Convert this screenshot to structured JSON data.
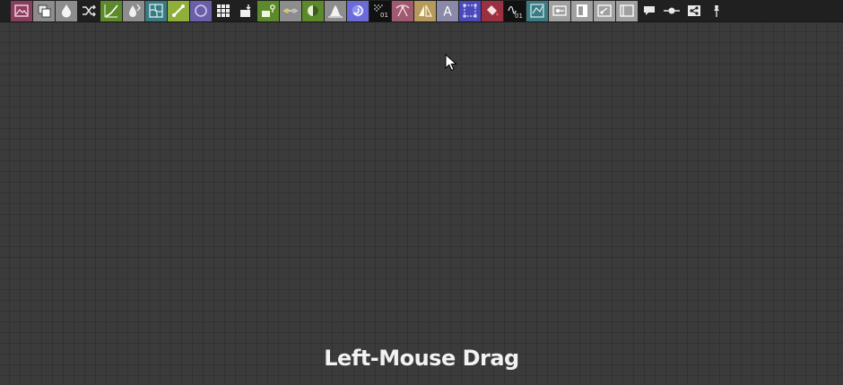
{
  "toolbar": {
    "colors": {
      "background": "#202020",
      "purple_red": "#8a3d5e",
      "grey": "#8d8d8d",
      "green": "#5c8a2a",
      "teal": "#3a7a82",
      "lime": "#8fae3a",
      "violet": "#6a5fa8",
      "blue_violet": "#6a6ad8",
      "black": "#111111",
      "rose": "#a05a70",
      "tan": "#b59a5c",
      "slate": "#8a8aa8",
      "indigo": "#4a4ab8",
      "crimson": "#9a3040",
      "light_grey": "#a0a0a0"
    },
    "buttons": [
      {
        "icon": "image-input-icon",
        "bg": "#8a3d5e"
      },
      {
        "icon": "uniform-color-icon",
        "bg": "#8d8d8d"
      },
      {
        "icon": "blur-drop-icon",
        "bg": "#8d8d8d"
      },
      {
        "icon": "shuffle-icon",
        "bg": "none"
      },
      {
        "icon": "curve-icon",
        "bg": "#5c8a2a"
      },
      {
        "icon": "levels-drop-icon",
        "bg": "#8d8d8d"
      },
      {
        "icon": "warp-icon",
        "bg": "#3a7a82"
      },
      {
        "icon": "gradient-map-icon",
        "bg": "#8fae3a"
      },
      {
        "icon": "circle-shape-icon",
        "bg": "#6a5fa8"
      },
      {
        "icon": "tile-grid-icon",
        "bg": "none"
      },
      {
        "icon": "output-bucket-icon",
        "bg": "none"
      },
      {
        "icon": "gradient-dynamic-icon",
        "bg": "#5c8a2a"
      },
      {
        "icon": "slider-node-icon",
        "bg": "#8d8d8d"
      },
      {
        "icon": "histogram-range-icon",
        "bg": "#5c8a2a"
      },
      {
        "icon": "histogram-scan-icon",
        "bg": "#8d8d8d"
      },
      {
        "icon": "swirl-icon",
        "bg": "#6a6ad8"
      },
      {
        "icon": "noise-01-icon",
        "bg": "#111111"
      },
      {
        "icon": "path-node-icon",
        "bg": "#a05a70"
      },
      {
        "icon": "mirror-icon",
        "bg": "#b59a5c"
      },
      {
        "icon": "text-icon",
        "bg": "#8a8aa8"
      },
      {
        "icon": "selection-box-icon",
        "bg": "#4a4ab8"
      },
      {
        "icon": "fill-bucket-icon",
        "bg": "#9a3040"
      },
      {
        "icon": "function-01-icon",
        "bg": "#111111"
      },
      {
        "icon": "distance-icon",
        "bg": "#3a7a82"
      },
      {
        "icon": "node-link-icon",
        "bg": "#a0a0a0"
      },
      {
        "icon": "bitmap-icon",
        "bg": "#a0a0a0"
      },
      {
        "icon": "node-graph-icon",
        "bg": "#a0a0a0"
      },
      {
        "icon": "frame-icon",
        "bg": "#a0a0a0"
      },
      {
        "icon": "comment-icon",
        "bg": "none"
      },
      {
        "icon": "dot-connector-icon",
        "bg": "none"
      },
      {
        "icon": "share-graph-icon",
        "bg": "none"
      },
      {
        "icon": "pin-icon",
        "bg": "none"
      }
    ],
    "glyphs": {
      "text_glyph": "A",
      "noise_digits": "01",
      "function_digits": "01"
    }
  },
  "canvas": {
    "grid_color": "#3b3b3b",
    "hint_text": "Left-Mouse Drag",
    "hint_color": "#f2f2f2"
  },
  "cursor": {
    "icon": "arrow-cursor-icon"
  }
}
